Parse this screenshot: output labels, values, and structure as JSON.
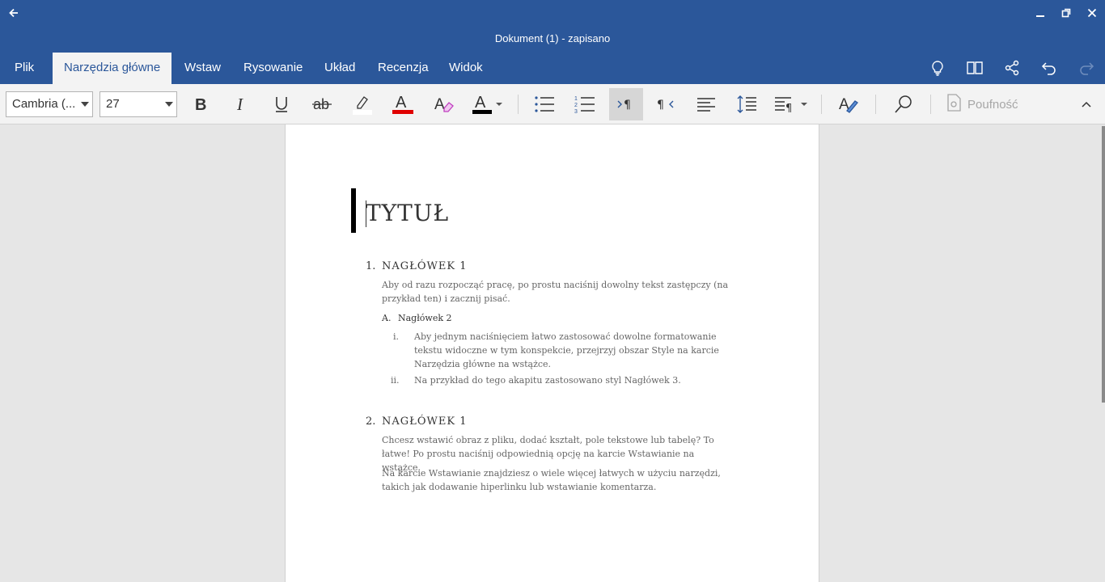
{
  "window": {
    "title": "Dokument (1) - zapisano",
    "back_icon": "back-arrow-icon",
    "controls": [
      "minimize-icon",
      "restore-icon",
      "close-icon"
    ]
  },
  "ribbon": {
    "tabs": [
      {
        "label": "Plik",
        "active": false
      },
      {
        "label": "Narzędzia główne",
        "active": true
      },
      {
        "label": "Wstaw",
        "active": false
      },
      {
        "label": "Rysowanie",
        "active": false
      },
      {
        "label": "Układ",
        "active": false
      },
      {
        "label": "Recenzja",
        "active": false
      },
      {
        "label": "Widok",
        "active": false
      }
    ],
    "right_icons": [
      "lightbulb-icon",
      "reading-view-icon",
      "share-icon",
      "undo-icon",
      "redo-icon"
    ]
  },
  "toolbar": {
    "font_name": "Cambria (...",
    "font_size": "27",
    "sensitivity_label": "Poufność",
    "colors": {
      "font_color": "#e00000",
      "highlight": "#ffffff",
      "text_color": "#000000",
      "accent": "#2b579a"
    }
  },
  "document": {
    "title": "TYTUŁ",
    "sections": [
      {
        "number": "1.",
        "heading": "NAGŁÓWEK 1",
        "paragraphs": [
          "Aby od razu rozpocząć pracę, po prostu naciśnij dowolny tekst zastępczy (na przykład ten) i zacznij pisać."
        ],
        "subheading": {
          "number": "A.",
          "text": "Nagłówek 2"
        },
        "items": [
          {
            "number": "i.",
            "text": "Aby jednym naciśnięciem łatwo zastosować dowolne formatowanie tekstu widoczne w tym konspekcie, przejrzyj obszar Style na karcie Narzędzia główne na wstążce."
          },
          {
            "number": "ii.",
            "text": "Na przykład do tego akapitu zastosowano styl Nagłówek 3."
          }
        ]
      },
      {
        "number": "2.",
        "heading": "NAGŁÓWEK 1",
        "paragraphs": [
          "Chcesz wstawić obraz z pliku, dodać kształt, pole tekstowe lub tabelę? To łatwe! Po prostu naciśnij odpowiednią opcję na karcie Wstawianie na wstążce.",
          "Na karcie Wstawianie znajdziesz o wiele więcej łatwych w użyciu narzędzi, takich jak dodawanie hiperlinku lub wstawianie komentarza."
        ]
      }
    ]
  }
}
